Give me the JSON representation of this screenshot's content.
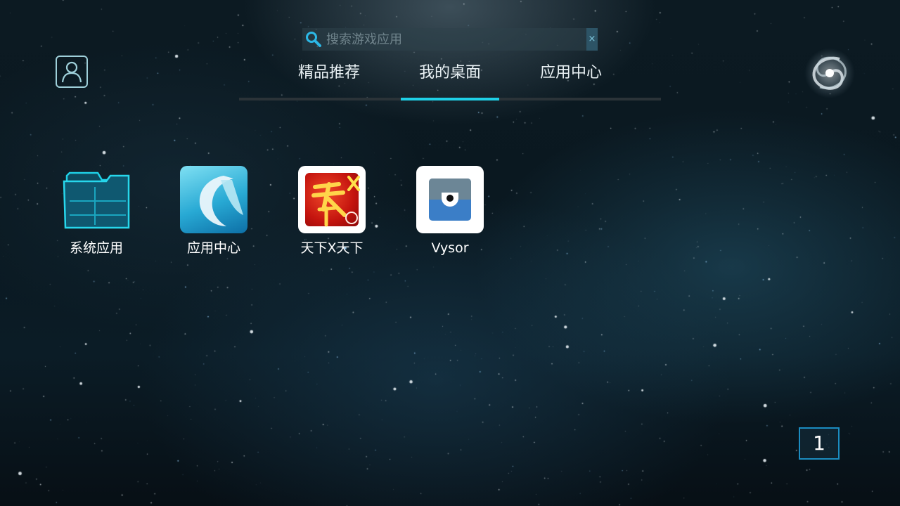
{
  "search": {
    "placeholder": "搜索游戏应用",
    "clear_label": "×"
  },
  "tabs": [
    {
      "label": "精品推荐",
      "active": false
    },
    {
      "label": "我的桌面",
      "active": true
    },
    {
      "label": "应用中心",
      "active": false
    }
  ],
  "colors": {
    "accent": "#1fd0e6",
    "tab_bar": "#2b3338",
    "page_border": "#1b8cc0"
  },
  "apps": [
    {
      "label": "系统应用",
      "icon": "folder-icon"
    },
    {
      "label": "应用中心",
      "icon": "app-center-icon"
    },
    {
      "label": "天下X天下",
      "icon": "tianxia-game-icon"
    },
    {
      "label": "Vysor",
      "icon": "vysor-icon"
    }
  ],
  "pager": {
    "current": "1"
  },
  "icons": {
    "profile": "user-profile-icon",
    "search": "search-icon",
    "galaxy": "galaxy-logo-icon"
  }
}
